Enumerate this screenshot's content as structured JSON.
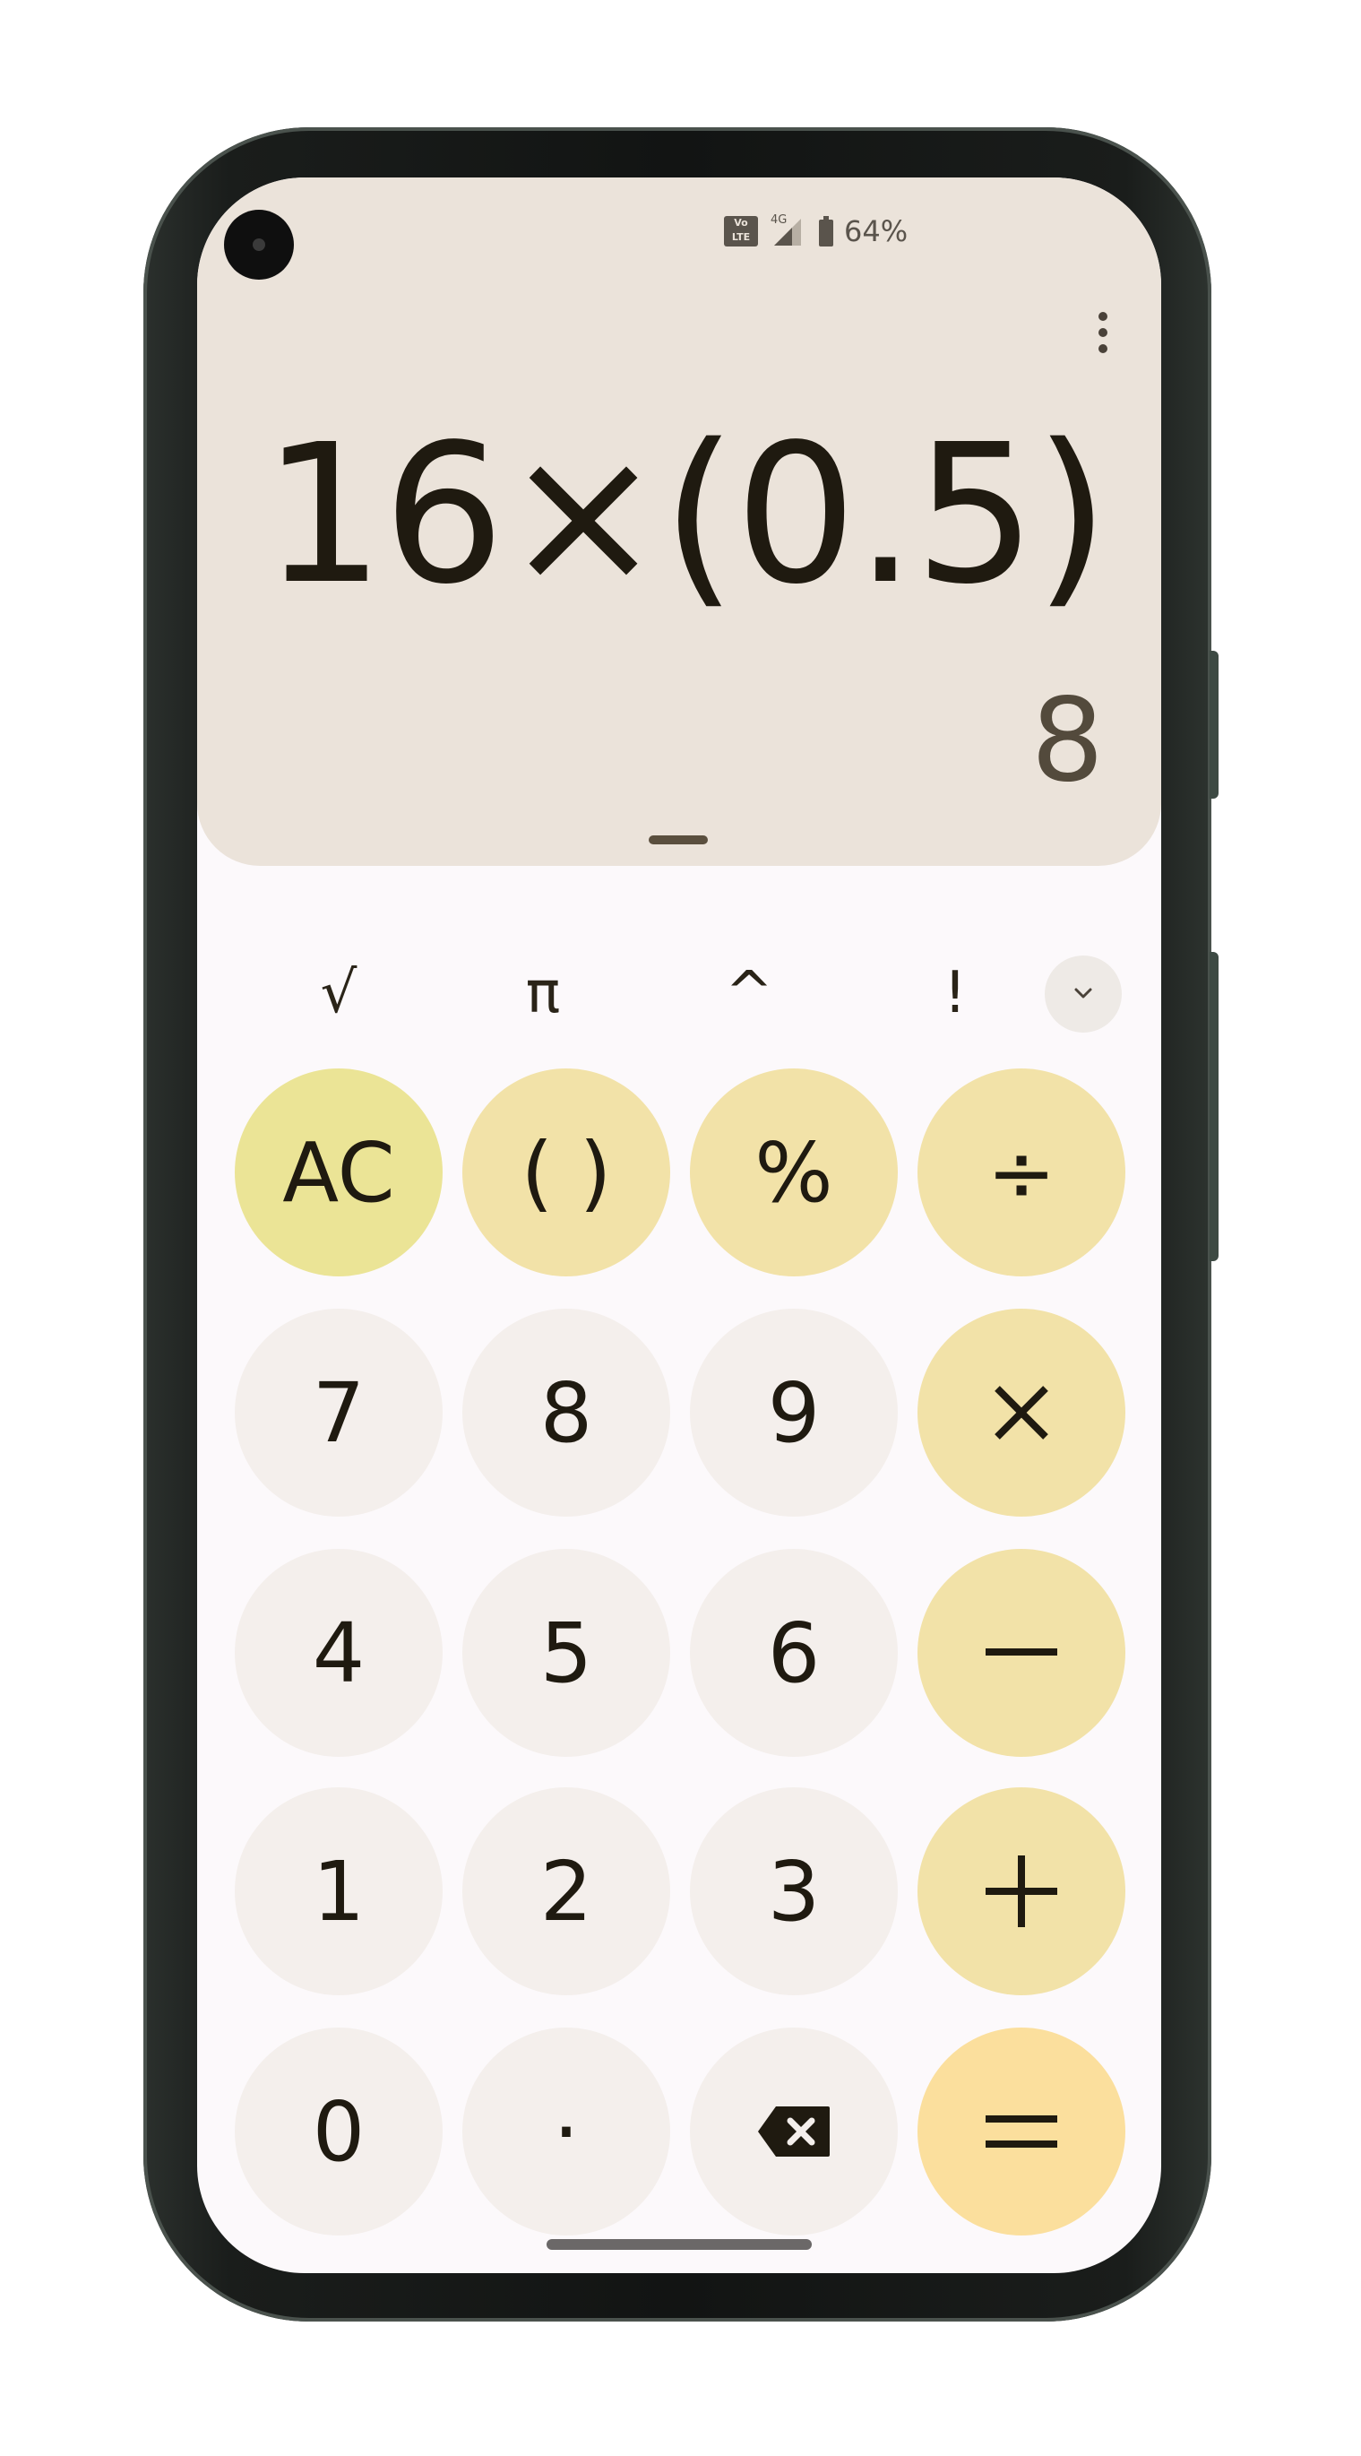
{
  "status_bar": {
    "volte_label": "Vo LTE",
    "network_label": "4G",
    "battery_percent": "64%"
  },
  "display": {
    "expression": "16×(0.5)",
    "result": "8"
  },
  "scientific_row": [
    {
      "label": "√",
      "name": "sqrt-button"
    },
    {
      "label": "π",
      "name": "pi-button"
    },
    {
      "label": "^",
      "name": "power-button"
    },
    {
      "label": "!",
      "name": "factorial-button"
    }
  ],
  "keypad": {
    "ac": "AC",
    "parens": "( )",
    "percent": "%",
    "divide": "÷",
    "seven": "7",
    "eight": "8",
    "nine": "9",
    "four": "4",
    "five": "5",
    "six": "6",
    "one": "1",
    "two": "2",
    "three": "3",
    "zero": "0",
    "decimal": "·"
  },
  "icons": {
    "multiply": "multiply-icon",
    "minus": "minus-icon",
    "plus": "plus-icon",
    "equals": "equals-icon",
    "backspace": "backspace-icon",
    "expand": "chevron-down-icon",
    "overflow": "more-vert-icon"
  },
  "colors": {
    "display_bg": "#ebe3da",
    "number_key": "#f4efec",
    "operator_key": "#f2e2a8",
    "ac_key": "#ebe496",
    "equals_key": "#fbdf9d",
    "text": "#1f1a10"
  }
}
